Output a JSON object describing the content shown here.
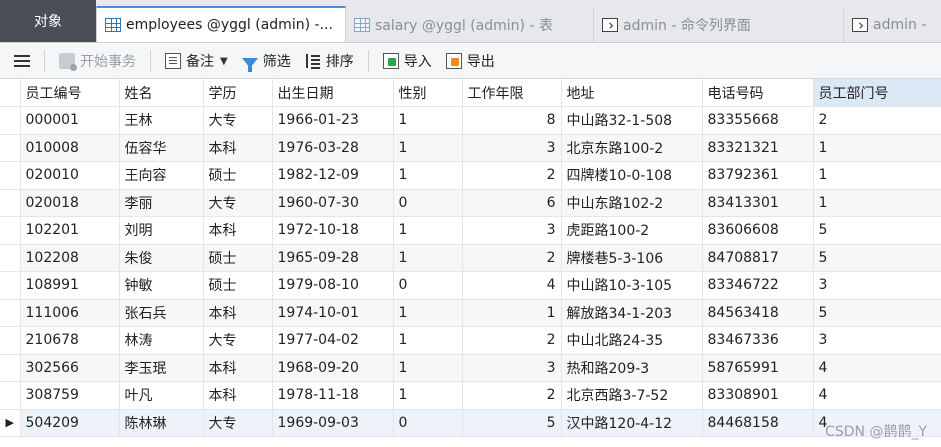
{
  "tabs": {
    "objects_label": "对象",
    "items": [
      {
        "label": "employees @yggl (admin) -...",
        "icon": "table-grid-icon"
      },
      {
        "label": "salary @yggl (admin) - 表",
        "icon": "table-grid-icon"
      },
      {
        "label": "admin - 命令列界面",
        "icon": "terminal-icon"
      },
      {
        "label": "admin -",
        "icon": "terminal-icon"
      }
    ]
  },
  "toolbar": {
    "menu_icon": "hamburger-menu-icon",
    "begin_transaction": "开始事务",
    "memo": "备注",
    "filter": "筛选",
    "sort": "排序",
    "import": "导入",
    "export": "导出"
  },
  "table": {
    "columns": [
      "员工编号",
      "姓名",
      "学历",
      "出生日期",
      "性别",
      "工作年限",
      "地址",
      "电话号码",
      "员工部门号"
    ],
    "rows": [
      [
        "000001",
        "王林",
        "大专",
        "1966-01-23",
        "1",
        "8",
        "中山路32-1-508",
        "83355668",
        "2"
      ],
      [
        "010008",
        "伍容华",
        "本科",
        "1976-03-28",
        "1",
        "3",
        "北京东路100-2",
        "83321321",
        "1"
      ],
      [
        "020010",
        "王向容",
        "硕士",
        "1982-12-09",
        "1",
        "2",
        "四牌楼10-0-108",
        "83792361",
        "1"
      ],
      [
        "020018",
        "李丽",
        "大专",
        "1960-07-30",
        "0",
        "6",
        "中山东路102-2",
        "83413301",
        "1"
      ],
      [
        "102201",
        "刘明",
        "本科",
        "1972-10-18",
        "1",
        "3",
        "虎距路100-2",
        "83606608",
        "5"
      ],
      [
        "102208",
        "朱俊",
        "硕士",
        "1965-09-28",
        "1",
        "2",
        "牌楼巷5-3-106",
        "84708817",
        "5"
      ],
      [
        "108991",
        "钟敏",
        "硕士",
        "1979-08-10",
        "0",
        "4",
        "中山路10-3-105",
        "83346722",
        "3"
      ],
      [
        "111006",
        "张石兵",
        "本科",
        "1974-10-01",
        "1",
        "1",
        "解放路34-1-203",
        "84563418",
        "5"
      ],
      [
        "210678",
        "林涛",
        "大专",
        "1977-04-02",
        "1",
        "2",
        "中山北路24-35",
        "83467336",
        "3"
      ],
      [
        "302566",
        "李玉珉",
        "本科",
        "1968-09-20",
        "1",
        "3",
        "热和路209-3",
        "58765991",
        "4"
      ],
      [
        "308759",
        "叶凡",
        "本科",
        "1978-11-18",
        "1",
        "2",
        "北京西路3-7-52",
        "83308901",
        "4"
      ],
      [
        "504209",
        "陈林琳",
        "大专",
        "1969-09-03",
        "0",
        "5",
        "汉中路120-4-12",
        "84468158",
        "4"
      ]
    ]
  },
  "watermark": "CSDN @鹊鹊_Y"
}
